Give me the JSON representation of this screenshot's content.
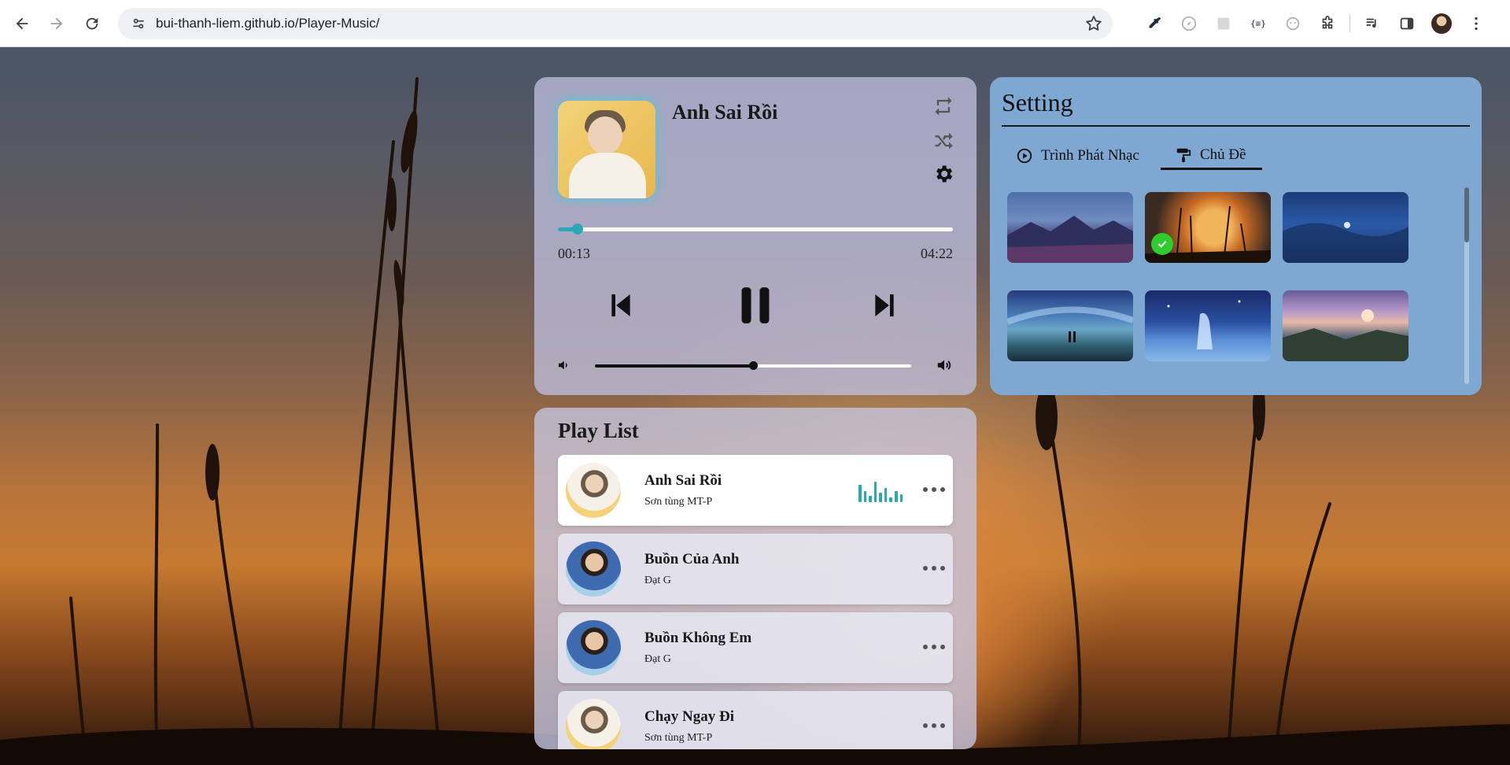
{
  "browser": {
    "url": "bui-thanh-liem.github.io/Player-Music/"
  },
  "player": {
    "current_title": "Anh Sai Rồi",
    "time_current": "00:13",
    "time_total": "04:22",
    "progress_fraction": 0.05,
    "volume_fraction": 0.5
  },
  "setting": {
    "title": "Setting",
    "tabs": [
      {
        "label": "Trình Phát Nhạc",
        "active": false
      },
      {
        "label": "Chủ Đề",
        "active": true
      }
    ],
    "themes": [
      {
        "name": "mountain-lake",
        "selected": false
      },
      {
        "name": "moon-grass",
        "selected": true
      },
      {
        "name": "night-lake",
        "selected": false
      },
      {
        "name": "galaxy-couple",
        "selected": false
      },
      {
        "name": "night-girl",
        "selected": false
      },
      {
        "name": "sunset-valley",
        "selected": false
      }
    ]
  },
  "playlist": {
    "title": "Play List",
    "items": [
      {
        "title": "Anh Sai Rồi",
        "artist": "Sơn tùng MT-P",
        "active": true
      },
      {
        "title": "Buồn Của Anh",
        "artist": "Đạt G",
        "active": false
      },
      {
        "title": "Buồn Không Em",
        "artist": "Đạt G",
        "active": false
      },
      {
        "title": "Chạy Ngay Đi",
        "artist": "Sơn tùng MT-P",
        "active": false
      }
    ]
  },
  "colors": {
    "accent": "#2ba8b8",
    "setting_bg": "#7ea8d2",
    "check": "#2ecc2e"
  }
}
